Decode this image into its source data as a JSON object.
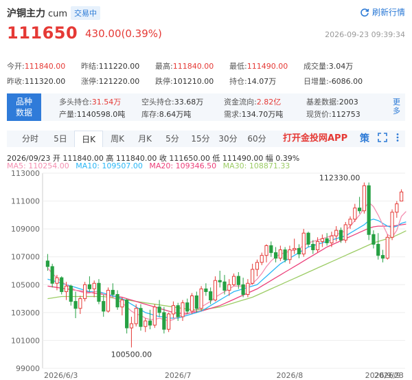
{
  "header": {
    "name": "沪铜主力",
    "code": "cum",
    "status": "交易中",
    "refresh_label": "刷新行情",
    "price": "111650",
    "change": "430.00(0.39%)",
    "datetime": "2026-09-23 09:39:34"
  },
  "stats": [
    {
      "label": "今开:",
      "value": "111840.00",
      "up": true
    },
    {
      "label": "昨结:",
      "value": "111220.00",
      "up": false
    },
    {
      "label": "最高:",
      "value": "111840.00",
      "up": true
    },
    {
      "label": "最低:",
      "value": "111490.00",
      "up": true
    },
    {
      "label": "成交量:",
      "value": "3.04万",
      "up": false
    },
    {
      "label": "昨收:",
      "value": "111320.00",
      "up": false
    },
    {
      "label": "涨停:",
      "value": "121220.00",
      "up": false
    },
    {
      "label": "跌停:",
      "value": "101210.00",
      "up": false
    },
    {
      "label": "持仓:",
      "value": "14.07万",
      "up": false
    },
    {
      "label": "日增量:",
      "value": "-6086.00",
      "up": false
    }
  ],
  "info": {
    "tag_line1": "品种",
    "tag_line2": "数据",
    "more_label": "更多",
    "items": [
      {
        "label": "多头持仓:",
        "value": "31.54万",
        "up": true
      },
      {
        "label": "空头持仓:",
        "value": "33.68万",
        "up": false
      },
      {
        "label": "资金流向:",
        "value": "2.82亿",
        "up": true
      },
      {
        "label": "基差数据:",
        "value": "2003",
        "up": false
      },
      {
        "label": "产量:",
        "value": "1140598.0吨",
        "up": false
      },
      {
        "label": "库存:",
        "value": "8.64万吨",
        "up": false
      },
      {
        "label": "需求:",
        "value": "134.70万吨",
        "up": false
      },
      {
        "label": "现货价:",
        "value": "112753",
        "up": false
      }
    ]
  },
  "tabs": [
    "分时",
    "5日",
    "日K",
    "周K",
    "月K",
    "5分",
    "15分",
    "30分",
    "60分"
  ],
  "active_tab": "日K",
  "app_link": "打开金投网APP",
  "toolbar": {
    "strategy_label": "策"
  },
  "ohlc_line": "2026/09/23  开 111840.00  高 111840.00  收 111650.00  低 111490.00  幅 0.39%",
  "ma": [
    {
      "label": "MA5: 110254.00",
      "color": "#f48fb1"
    },
    {
      "label": "MA10: 109507.00",
      "color": "#29b6f6"
    },
    {
      "label": "MA20: 109346.50",
      "color": "#ec407a"
    },
    {
      "label": "MA30: 108871.33",
      "color": "#9ccc65"
    }
  ],
  "colors": {
    "up": "#e53935",
    "down": "#26a043",
    "accent": "#2c7ad6"
  },
  "chart_data": {
    "type": "candlestick",
    "y_ticks": [
      99000,
      101000,
      103000,
      105000,
      107000,
      109000,
      111000,
      113000
    ],
    "ylim": [
      99000,
      113000
    ],
    "x_labels": [
      "2026/6/3",
      "2026/7",
      "2026/8",
      "2026/9",
      "2026/9/23"
    ],
    "annotations": [
      {
        "text": "112330.00",
        "value": 112330
      },
      {
        "text": "100500.00",
        "value": 100500
      }
    ],
    "ohlc": [
      [
        106700,
        107200,
        106000,
        106300
      ],
      [
        106300,
        106500,
        104800,
        105100
      ],
      [
        105100,
        105700,
        104600,
        105500
      ],
      [
        105500,
        105600,
        104300,
        104500
      ],
      [
        104500,
        105200,
        103900,
        104900
      ],
      [
        104900,
        105000,
        103500,
        103800
      ],
      [
        103800,
        104500,
        102600,
        103300
      ],
      [
        103300,
        104200,
        102900,
        104000
      ],
      [
        104000,
        105200,
        103800,
        105000
      ],
      [
        105000,
        105600,
        104500,
        104700
      ],
      [
        104700,
        105300,
        104100,
        105100
      ],
      [
        105100,
        105400,
        103600,
        103800
      ],
      [
        103800,
        104300,
        102700,
        103100
      ],
      [
        103100,
        104800,
        103000,
        104600
      ],
      [
        104600,
        105100,
        104100,
        104300
      ],
      [
        104300,
        104600,
        103200,
        103400
      ],
      [
        103400,
        104100,
        102800,
        103900
      ],
      [
        103900,
        104000,
        101500,
        101900
      ],
      [
        101900,
        102700,
        100500,
        102200
      ],
      [
        102200,
        103600,
        102000,
        103300
      ],
      [
        103300,
        103600,
        101700,
        102000
      ],
      [
        102000,
        102600,
        101600,
        102400
      ],
      [
        102400,
        103200,
        101800,
        102100
      ],
      [
        102100,
        103600,
        101900,
        103400
      ],
      [
        103400,
        103900,
        102700,
        103000
      ],
      [
        103000,
        103400,
        101500,
        101800
      ],
      [
        101800,
        103000,
        101600,
        102900
      ],
      [
        102900,
        103800,
        102600,
        103500
      ],
      [
        103500,
        103700,
        102400,
        102700
      ],
      [
        102700,
        103900,
        102400,
        103700
      ],
      [
        103700,
        104000,
        102900,
        103100
      ],
      [
        103100,
        104400,
        102900,
        104200
      ],
      [
        104200,
        104500,
        103000,
        103300
      ],
      [
        103300,
        104900,
        103100,
        104700
      ],
      [
        104700,
        105100,
        104200,
        104500
      ],
      [
        104500,
        104800,
        103600,
        103900
      ],
      [
        103900,
        105600,
        103800,
        105300
      ],
      [
        105300,
        106000,
        104800,
        105200
      ],
      [
        105200,
        105700,
        104300,
        104600
      ],
      [
        104600,
        105400,
        104200,
        105000
      ],
      [
        105000,
        105800,
        104900,
        105600
      ],
      [
        105600,
        105900,
        104700,
        105000
      ],
      [
        105000,
        105500,
        104100,
        104300
      ],
      [
        104300,
        105400,
        104100,
        105100
      ],
      [
        105100,
        106500,
        105000,
        106100
      ],
      [
        106100,
        106800,
        105600,
        106600
      ],
      [
        106600,
        107300,
        106400,
        107100
      ],
      [
        107100,
        107900,
        106600,
        107800
      ],
      [
        107800,
        108100,
        107000,
        107300
      ],
      [
        107300,
        107700,
        106600,
        106900
      ],
      [
        106900,
        107800,
        106700,
        107500
      ],
      [
        107500,
        107700,
        106600,
        106800
      ],
      [
        106800,
        107800,
        106500,
        107500
      ],
      [
        107500,
        108300,
        107200,
        107600
      ],
      [
        107600,
        107900,
        106900,
        107200
      ],
      [
        107200,
        109000,
        107000,
        108700
      ],
      [
        108700,
        108800,
        107700,
        107900
      ],
      [
        107900,
        108200,
        107200,
        107500
      ],
      [
        107500,
        108400,
        107300,
        108100
      ],
      [
        108100,
        108600,
        107700,
        108300
      ],
      [
        108300,
        108700,
        107800,
        108000
      ],
      [
        108000,
        108800,
        107700,
        108500
      ],
      [
        108500,
        109200,
        108100,
        108900
      ],
      [
        108900,
        109100,
        108000,
        108200
      ],
      [
        108200,
        109500,
        108000,
        109300
      ],
      [
        109300,
        109900,
        109000,
        109700
      ],
      [
        109700,
        110800,
        109500,
        110500
      ],
      [
        110500,
        111300,
        110100,
        110300
      ],
      [
        110300,
        112330,
        110100,
        112100
      ],
      [
        112100,
        112330,
        108200,
        108600
      ],
      [
        108600,
        108900,
        107600,
        107900
      ],
      [
        107900,
        108700,
        106800,
        107100
      ],
      [
        107100,
        107500,
        106600,
        106900
      ],
      [
        106900,
        108600,
        106800,
        108400
      ],
      [
        108400,
        110400,
        108200,
        110200
      ],
      [
        110200,
        111000,
        109800,
        110800
      ],
      [
        111000,
        111840,
        111490,
        111650
      ]
    ],
    "ma5": [
      106200,
      105800,
      105500,
      105200,
      105000,
      104800,
      104600,
      104500,
      104400,
      104400,
      104500,
      104500,
      104300,
      104200,
      104100,
      103900,
      103700,
      103400,
      103100,
      102900,
      102800,
      102600,
      102500,
      102500,
      102600,
      102500,
      102400,
      102500,
      102700,
      102800,
      102900,
      103000,
      103200,
      103400,
      103600,
      103800,
      104100,
      104300,
      104500,
      104700,
      104900,
      104900,
      104900,
      104900,
      105100,
      105400,
      105800,
      106300,
      106700,
      107000,
      107200,
      107300,
      107400,
      107500,
      107600,
      107800,
      108000,
      108100,
      108200,
      108300,
      108400,
      108500,
      108600,
      108700,
      108900,
      109200,
      109600,
      110000,
      110500,
      110900,
      110600,
      110000,
      109300,
      108600,
      108400,
      108900,
      109900,
      110254
    ],
    "ma10": [
      105400,
      105300,
      105200,
      105100,
      105000,
      104900,
      104800,
      104700,
      104600,
      104500,
      104500,
      104500,
      104400,
      104300,
      104200,
      104100,
      104000,
      103800,
      103600,
      103400,
      103200,
      103000,
      102900,
      102800,
      102700,
      102700,
      102600,
      102600,
      102600,
      102700,
      102800,
      102900,
      103000,
      103100,
      103300,
      103500,
      103700,
      103900,
      104100,
      104300,
      104500,
      104600,
      104700,
      104800,
      104900,
      105000,
      105300,
      105600,
      105900,
      106200,
      106500,
      106700,
      106900,
      107100,
      107300,
      107500,
      107700,
      107800,
      107900,
      108000,
      108100,
      108200,
      108300,
      108400,
      108500,
      108700,
      108900,
      109100,
      109300,
      109600,
      109700,
      109600,
      109400,
      109200,
      109100,
      109200,
      109400,
      109507
    ],
    "ma20": [
      104900,
      104850,
      104800,
      104750,
      104700,
      104650,
      104600,
      104550,
      104500,
      104450,
      104400,
      104350,
      104300,
      104250,
      104200,
      104150,
      104100,
      104000,
      103900,
      103800,
      103700,
      103600,
      103500,
      103400,
      103300,
      103200,
      103100,
      103000,
      102950,
      102950,
      102950,
      103000,
      103050,
      103100,
      103200,
      103300,
      103400,
      103500,
      103650,
      103800,
      103950,
      104100,
      104250,
      104400,
      104550,
      104700,
      104900,
      105100,
      105300,
      105500,
      105700,
      105900,
      106100,
      106300,
      106500,
      106700,
      106900,
      107100,
      107300,
      107500,
      107700,
      107850,
      108000,
      108150,
      108300,
      108450,
      108600,
      108750,
      108900,
      109050,
      109150,
      109200,
      109200,
      109200,
      109200,
      109250,
      109300,
      109346
    ],
    "ma30": [
      104000,
      104050,
      104100,
      104150,
      104150,
      104150,
      104150,
      104150,
      104150,
      104150,
      104150,
      104150,
      104150,
      104100,
      104050,
      104000,
      103950,
      103900,
      103850,
      103800,
      103750,
      103700,
      103650,
      103600,
      103550,
      103500,
      103450,
      103400,
      103350,
      103300,
      103250,
      103200,
      103200,
      103200,
      103250,
      103300,
      103350,
      103400,
      103500,
      103600,
      103700,
      103800,
      103900,
      104000,
      104100,
      104250,
      104400,
      104550,
      104700,
      104850,
      105000,
      105150,
      105300,
      105450,
      105600,
      105750,
      105900,
      106050,
      106200,
      106350,
      106500,
      106650,
      106800,
      106950,
      107100,
      107250,
      107400,
      107550,
      107700,
      107850,
      108000,
      108100,
      108200,
      108300,
      108400,
      108550,
      108700,
      108871
    ]
  }
}
